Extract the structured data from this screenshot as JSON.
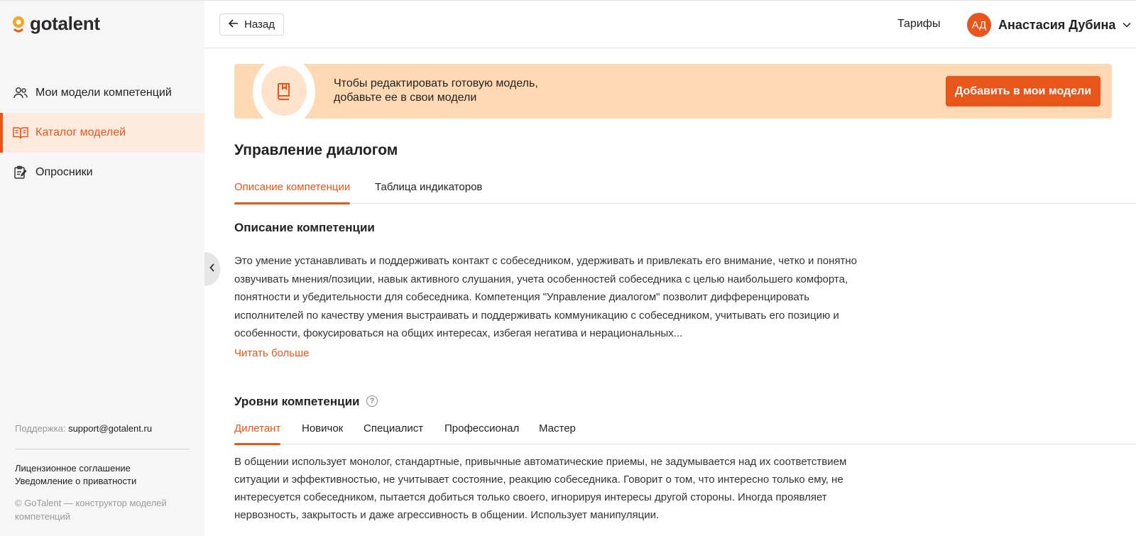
{
  "brand": {
    "name": "gotalent",
    "accent": "#e8561b"
  },
  "sidebar": {
    "items": [
      {
        "label": "Мои модели компетенций",
        "icon": "users-icon",
        "active": false
      },
      {
        "label": "Каталог моделей",
        "icon": "book-open-icon",
        "active": true
      },
      {
        "label": "Опросники",
        "icon": "survey-icon",
        "active": false
      }
    ],
    "support_label": "Поддержка:",
    "support_email": "support@gotalent.ru",
    "license": "Лицензионное соглашение",
    "privacy": "Уведомление о приватности",
    "copyright": "© GoTalent — конструктор моделей компетенций"
  },
  "header": {
    "back_label": "Назад",
    "tariffs": "Тарифы",
    "user_initials": "АД",
    "user_name": "Анастасия Дубина"
  },
  "banner": {
    "line1": "Чтобы редактировать готовую модель,",
    "line2": "добавьте ее в свои модели",
    "button": "Добавить в мои модели"
  },
  "main": {
    "title": "Управление диалогом",
    "tabs": [
      {
        "label": "Описание компетенции",
        "active": true
      },
      {
        "label": "Таблица индикаторов",
        "active": false
      }
    ],
    "description_title": "Описание компетенции",
    "description": "Это умение устанавливать и поддерживать контакт с собеседником, удерживать и привлекать его внимание, четко и понятно озвучивать мнения/позиции, навык активного слушания, учета особенностей собеседника с целью наибольшего комфорта, понятности и убедительности для собеседника. Компетенция \"Управление диалогом\" позволит дифференцировать исполнителей по качеству умения выстраивать и поддерживать коммуникацию с собеседником, учитывать его позицию и особенности, фокусироваться на общих интересах, избегая негатива и нерациональных...",
    "read_more": "Читать больше",
    "levels_title": "Уровни компетенции",
    "levels": [
      {
        "label": "Дилетант",
        "active": true
      },
      {
        "label": "Новичок",
        "active": false
      },
      {
        "label": "Специалист",
        "active": false
      },
      {
        "label": "Профессионал",
        "active": false
      },
      {
        "label": "Мастер",
        "active": false
      }
    ],
    "level_text": "В общении использует монолог, стандартные, привычные автоматические приемы, не задумывается над их соответствием ситуации и эффективностью, не учитывает состояние, реакцию собеседника. Говорит о том, что интересно только ему, не интересуется собеседником, пытается добиться только своего, игнорируя интересы другой стороны. Иногда проявляет нервозность, закрытость и даже агрессивность в общении. Использует манипуляции."
  }
}
